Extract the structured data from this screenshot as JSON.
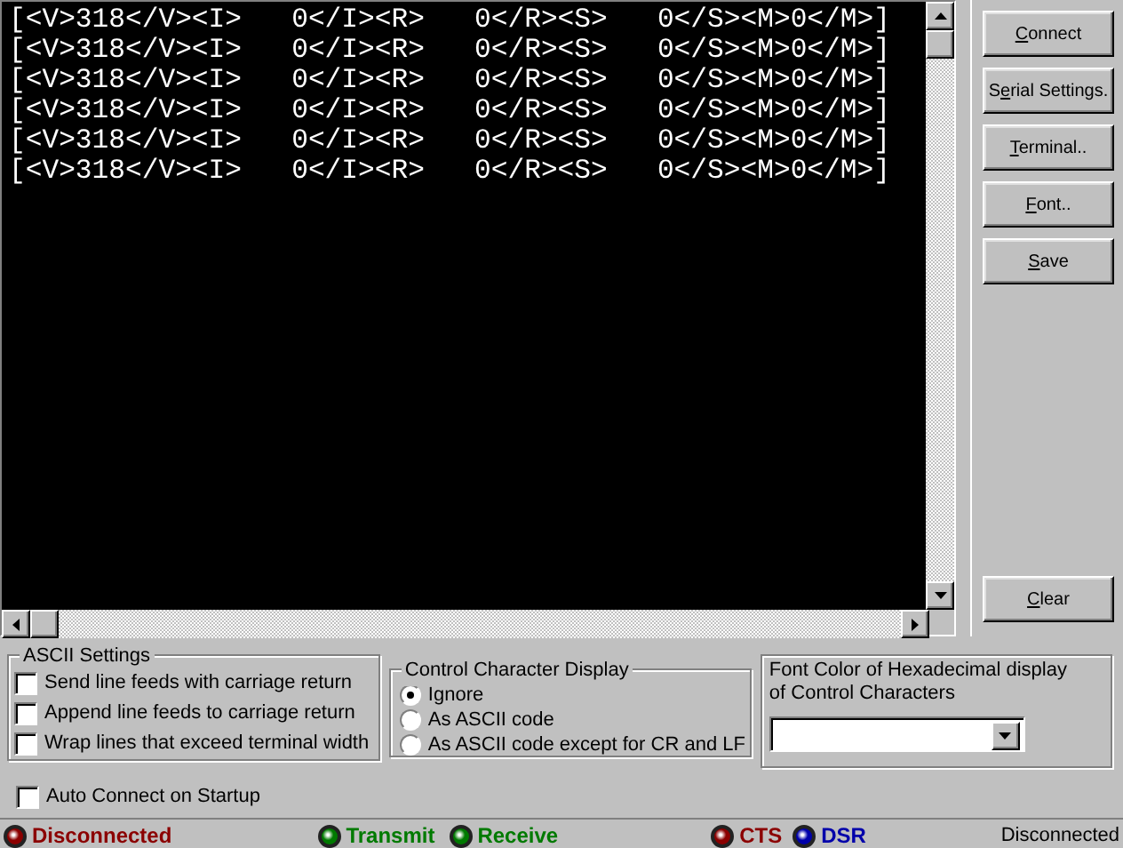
{
  "terminal": {
    "lines": [
      "[<V>318</V><I>   0</I><R>   0</R><S>   0</S><M>0</M>]",
      "[<V>318</V><I>   0</I><R>   0</R><S>   0</S><M>0</M>]",
      "[<V>318</V><I>   0</I><R>   0</R><S>   0</S><M>0</M>]",
      "[<V>318</V><I>   0</I><R>   0</R><S>   0</S><M>0</M>]",
      "[<V>318</V><I>   0</I><R>   0</R><S>   0</S><M>0</M>]",
      "[<V>318</V><I>   0</I><R>   0</R><S>   0</S><M>0</M>]"
    ]
  },
  "buttons": [
    {
      "mnemonic": "C",
      "suffix": "onnect"
    },
    {
      "prefix": "S",
      "mnemonic": "e",
      "suffix": "rial Settings."
    },
    {
      "mnemonic": "T",
      "suffix": "erminal.."
    },
    {
      "mnemonic": "F",
      "suffix": "ont.."
    },
    {
      "mnemonic": "S",
      "suffix": "ave"
    }
  ],
  "clear_button": {
    "mnemonic": "C",
    "suffix": "lear"
  },
  "ascii_settings": {
    "title": "ASCII Settings",
    "options": [
      {
        "label": "Send line feeds with carriage return",
        "checked": false
      },
      {
        "label": "Append line feeds to carriage return",
        "checked": false
      },
      {
        "label": "Wrap lines that exceed terminal width",
        "checked": false
      }
    ]
  },
  "control_character_display": {
    "title": "Control Character Display",
    "options": [
      {
        "label": "Ignore",
        "selected": true
      },
      {
        "label": "As ASCII code",
        "selected": false
      },
      {
        "label": "As ASCII code except for CR and LF",
        "selected": false
      }
    ]
  },
  "font_color": {
    "label": "Font Color of Hexadecimal display of Control Characters"
  },
  "auto_connect": {
    "label": "Auto Connect on Startup",
    "checked": false
  },
  "status_bar": {
    "indicators": [
      {
        "label": "Disconnected",
        "color": "#8b0000"
      },
      {
        "label": "Transmit",
        "color": "#007a00"
      },
      {
        "label": "Receive",
        "color": "#007a00"
      },
      {
        "label": "CTS",
        "color": "#8b0000"
      },
      {
        "label": "DSR",
        "color": "#0000aa"
      }
    ],
    "status": "Disconnected"
  }
}
